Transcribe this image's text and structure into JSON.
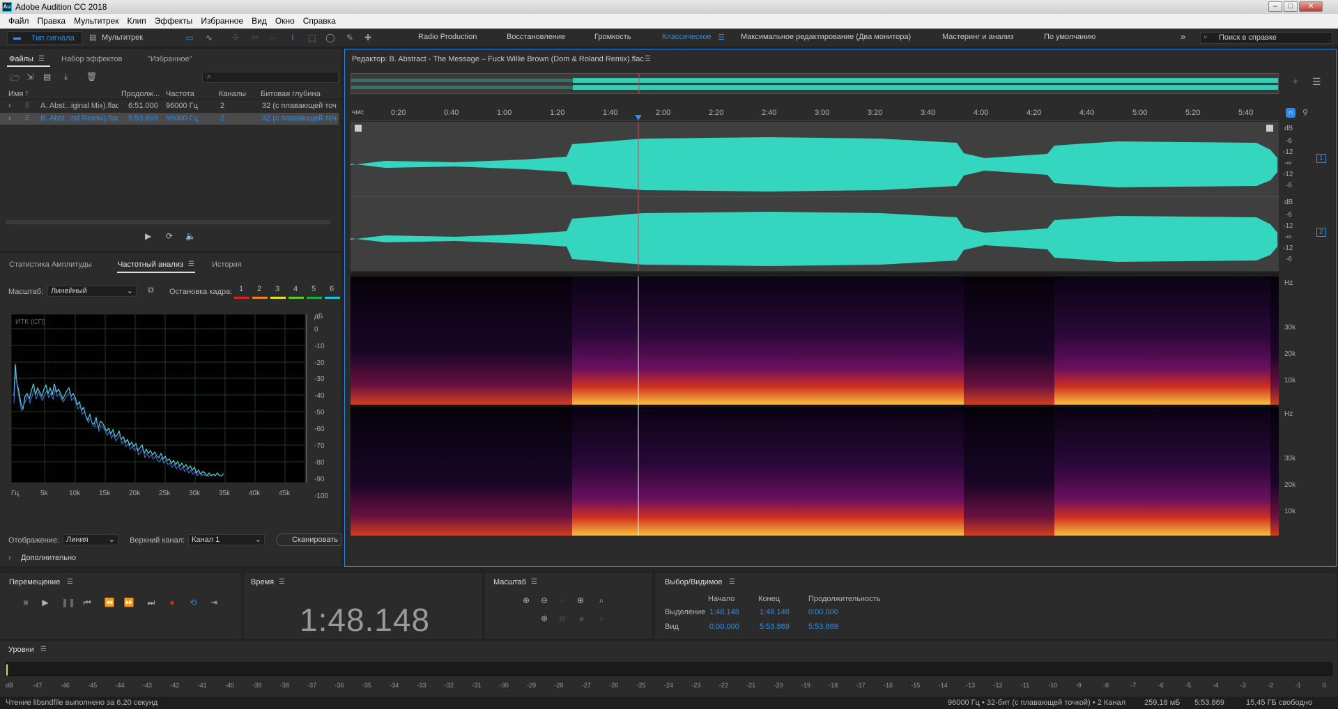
{
  "window": {
    "title": "Adobe Audition CC 2018",
    "logo": "Au"
  },
  "menu": [
    "Файл",
    "Правка",
    "Мультитрек",
    "Клип",
    "Эффекты",
    "Избранное",
    "Вид",
    "Окно",
    "Справка"
  ],
  "toolbar": {
    "mode_waveform": "Тип сигнала",
    "mode_multitrack": "Мультитрек",
    "workspaces": [
      "Radio Production",
      "Восстановление",
      "Громкость",
      "Классическое",
      "Максимальное редактирование (Два монитора)",
      "Мастеринг и анализ",
      "По умолчанию"
    ],
    "active_workspace": "Классическое",
    "search_placeholder": "Поиск в справке"
  },
  "files_panel": {
    "tabs": [
      "Файлы",
      "Набор эффектов",
      "\"Избранное\""
    ],
    "columns": [
      "Имя",
      "Продолж...",
      "Частота",
      "Каналы",
      "Битовая глубина"
    ],
    "rows": [
      {
        "name": "A. Abst...iginal Mix).flac",
        "duration": "6:51.000",
        "rate": "96000 Гц",
        "channels": "2",
        "depth": "32 (с плавающей точ"
      },
      {
        "name": "B. Abst...nd Remix).flac",
        "duration": "5:53.869",
        "rate": "96000 Гц",
        "channels": "2",
        "depth": "32 (с плавающей точ"
      }
    ]
  },
  "analysis_panel": {
    "tabs": [
      "Статистика Амплитуды",
      "Частотный анализ",
      "История"
    ],
    "scale_label": "Масштаб:",
    "scale_value": "Линейный",
    "hold_label": "Остановка кадра:",
    "hold_buttons": [
      "1",
      "2",
      "3",
      "4",
      "5",
      "6"
    ],
    "hold_colors": [
      "#e02020",
      "#f08020",
      "#e8e020",
      "#60d020",
      "#20b040",
      "#20c0e0"
    ],
    "graph_label": "ИТК (СП)",
    "db_unit": "дБ",
    "y_ticks": [
      "0",
      "-10",
      "-20",
      "-30",
      "-40",
      "-50",
      "-60",
      "-70",
      "-80",
      "-90",
      "-100"
    ],
    "x_ticks": [
      "Гц",
      "5k",
      "10k",
      "15k",
      "20k",
      "25k",
      "30k",
      "35k",
      "40k",
      "45k"
    ],
    "display_label": "Отображение:",
    "display_value": "Линия",
    "channel_label": "Верхний канал:",
    "channel_value": "Канал 1",
    "scan_button": "Сканировать",
    "advanced": "Дополнительно"
  },
  "editor": {
    "title": "Редактор: B. Abstract - The Message – Fuck Willie Brown (Dom & Roland Remix).flac",
    "ruler_unit": "чмс",
    "ruler": [
      "0:20",
      "0:40",
      "1:00",
      "1:20",
      "1:40",
      "2:00",
      "2:20",
      "2:40",
      "3:00",
      "3:20",
      "3:40",
      "4:00",
      "4:20",
      "4:40",
      "5:00",
      "5:20",
      "5:40"
    ],
    "db_labels": [
      "dB",
      "-6",
      "-12",
      "-∞",
      "-12",
      "-6"
    ],
    "hz_labels": [
      "Hz",
      "30k",
      "20k",
      "10k"
    ],
    "channels": [
      "1",
      "2"
    ]
  },
  "transport": {
    "title": "Перемещение"
  },
  "time_panel": {
    "title": "Время",
    "value": "1:48.148"
  },
  "zoom_panel": {
    "title": "Масштаб"
  },
  "selection_panel": {
    "title": "Выбор/Видимое",
    "cols": [
      "Начало",
      "Конец",
      "Продолжительность"
    ],
    "sel_label": "Выделение",
    "sel": [
      "1:48.148",
      "1:48.148",
      "0:00.000"
    ],
    "view_label": "Вид",
    "view": [
      "0:00.000",
      "5:53.869",
      "5:53.869"
    ]
  },
  "levels": {
    "title": "Уровни",
    "scale": [
      "dB",
      "-47",
      "-46",
      "-45",
      "-44",
      "-43",
      "-42",
      "-41",
      "-40",
      "-39",
      "-38",
      "-37",
      "-36",
      "-35",
      "-34",
      "-33",
      "-32",
      "-31",
      "-30",
      "-29",
      "-28",
      "-27",
      "-26",
      "-25",
      "-24",
      "-23",
      "-22",
      "-21",
      "-20",
      "-19",
      "-18",
      "-17",
      "-16",
      "-15",
      "-14",
      "-13",
      "-12",
      "-11",
      "-10",
      "-9",
      "-8",
      "-7",
      "-6",
      "-5",
      "-4",
      "-3",
      "-2",
      "-1",
      "0"
    ]
  },
  "status": {
    "left": "Чтение libsndfile выполнено за 6,20 секунд",
    "format": "96000 Гц • 32-бит (с плавающей точкой) • 2 Канал",
    "size": "259,18 мБ",
    "duration": "5:53.869",
    "free": "15,45 ГБ свободно"
  },
  "colors": {
    "accent": "#2d8ceb",
    "waveform": "#35d6bf",
    "playhead": "#e04040"
  }
}
